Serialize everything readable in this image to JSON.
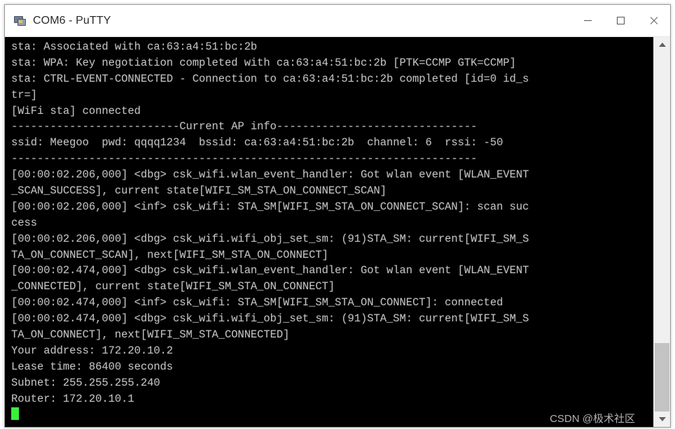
{
  "window": {
    "title": "COM6 - PuTTY",
    "icon": "putty-computer-icon",
    "controls": {
      "minimize_label": "Minimize",
      "maximize_label": "Maximize",
      "close_label": "Close"
    }
  },
  "terminal": {
    "background_color": "#000000",
    "foreground_color": "#bfbfbf",
    "cursor_color": "#39f039",
    "lines": [
      "sta: Associated with ca:63:a4:51:bc:2b",
      "sta: WPA: Key negotiation completed with ca:63:a4:51:bc:2b [PTK=CCMP GTK=CCMP]",
      "sta: CTRL-EVENT-CONNECTED - Connection to ca:63:a4:51:bc:2b completed [id=0 id_s",
      "tr=]",
      "[WiFi sta] connected",
      "--------------------------Current AP info-------------------------------",
      "ssid: Meegoo  pwd: qqqq1234  bssid: ca:63:a4:51:bc:2b  channel: 6  rssi: -50",
      "------------------------------------------------------------------------",
      "[00:00:02.206,000] <dbg> csk_wifi.wlan_event_handler: Got wlan event [WLAN_EVENT",
      "_SCAN_SUCCESS], current state[WIFI_SM_STA_ON_CONNECT_SCAN]",
      "[00:00:02.206,000] <inf> csk_wifi: STA_SM[WIFI_SM_STA_ON_CONNECT_SCAN]: scan suc",
      "cess",
      "[00:00:02.206,000] <dbg> csk_wifi.wifi_obj_set_sm: (91)STA_SM: current[WIFI_SM_S",
      "TA_ON_CONNECT_SCAN], next[WIFI_SM_STA_ON_CONNECT]",
      "[00:00:02.474,000] <dbg> csk_wifi.wlan_event_handler: Got wlan event [WLAN_EVENT",
      "_CONNECTED], current state[WIFI_SM_STA_ON_CONNECT]",
      "[00:00:02.474,000] <inf> csk_wifi: STA_SM[WIFI_SM_STA_ON_CONNECT]: connected",
      "[00:00:02.474,000] <dbg> csk_wifi.wifi_obj_set_sm: (91)STA_SM: current[WIFI_SM_S",
      "TA_ON_CONNECT], next[WIFI_SM_STA_CONNECTED]",
      "Your address: 172.20.10.2",
      "Lease time: 86400 seconds",
      "Subnet: 255.255.255.240",
      "Router: 172.20.10.1"
    ],
    "ap_info": {
      "ssid": "Meegoo",
      "pwd": "qqqq1234",
      "bssid": "ca:63:a4:51:bc:2b",
      "channel": "6",
      "rssi": "-50"
    },
    "dhcp_info": {
      "your_address": "172.20.10.2",
      "lease_time": "86400 seconds",
      "subnet": "255.255.255.240",
      "router": "172.20.10.1"
    }
  },
  "scrollbar": {
    "up_arrow": "chevron-up-icon",
    "down_arrow": "chevron-down-icon"
  },
  "watermark": {
    "text": "CSDN @极术社区"
  }
}
